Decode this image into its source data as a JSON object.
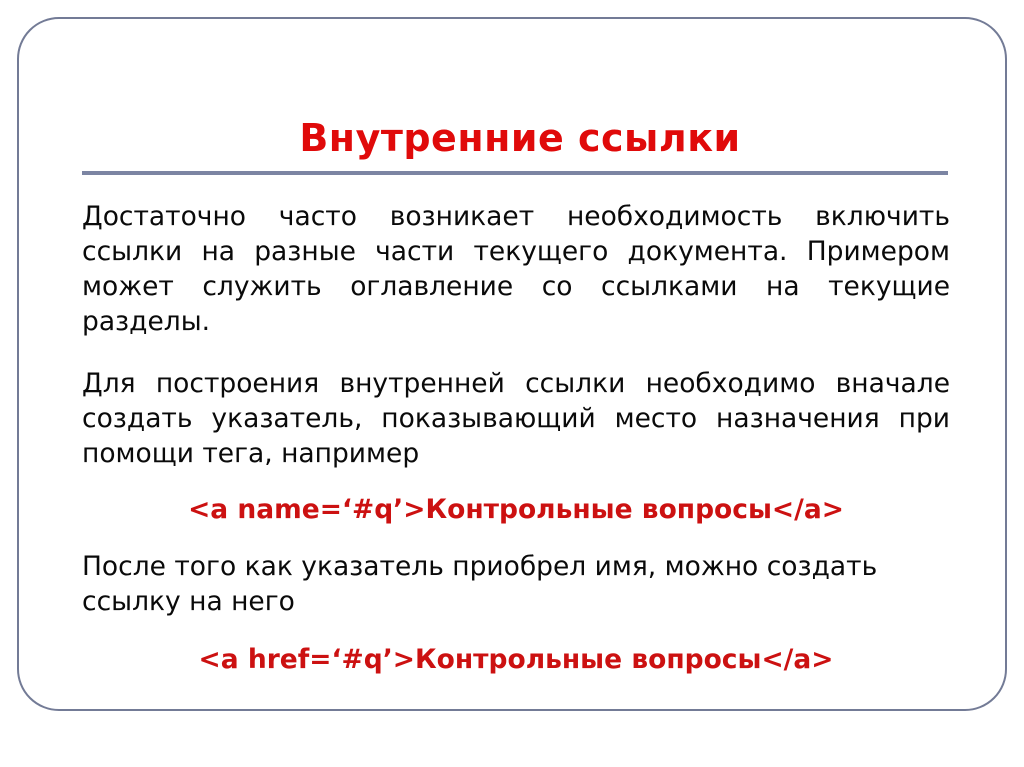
{
  "slide": {
    "title": "Внутренние ссылки",
    "paragraphs": [
      {
        "id": "intro",
        "text": "Достаточно часто возникает необходимость включить ссылки на разные части текущего документа. Примером может служить оглавление со ссылками  на текущие разделы."
      },
      {
        "id": "anchor-instructions",
        "text": "Для построения внутренней ссылки необходимо вначале создать указатель, показывающий место назначения при помощи тега, например"
      },
      {
        "id": "link-instructions",
        "text": "После того как указатель приобрел имя, можно создать ссылку на него"
      }
    ],
    "code_examples": [
      {
        "id": "anchor-name",
        "text": "<a name=‘#q’>Контрольные вопросы</a>"
      },
      {
        "id": "anchor-href",
        "text": "<a href=‘#q’>Контрольные вопросы</a>"
      }
    ],
    "colors": {
      "title_red": "#e00a0a",
      "code_red": "#cc1111",
      "rule_slate": "#7c85a3",
      "frame_border": "#737b96",
      "body_text": "#0a0a0a",
      "background": "#ffffff"
    }
  }
}
